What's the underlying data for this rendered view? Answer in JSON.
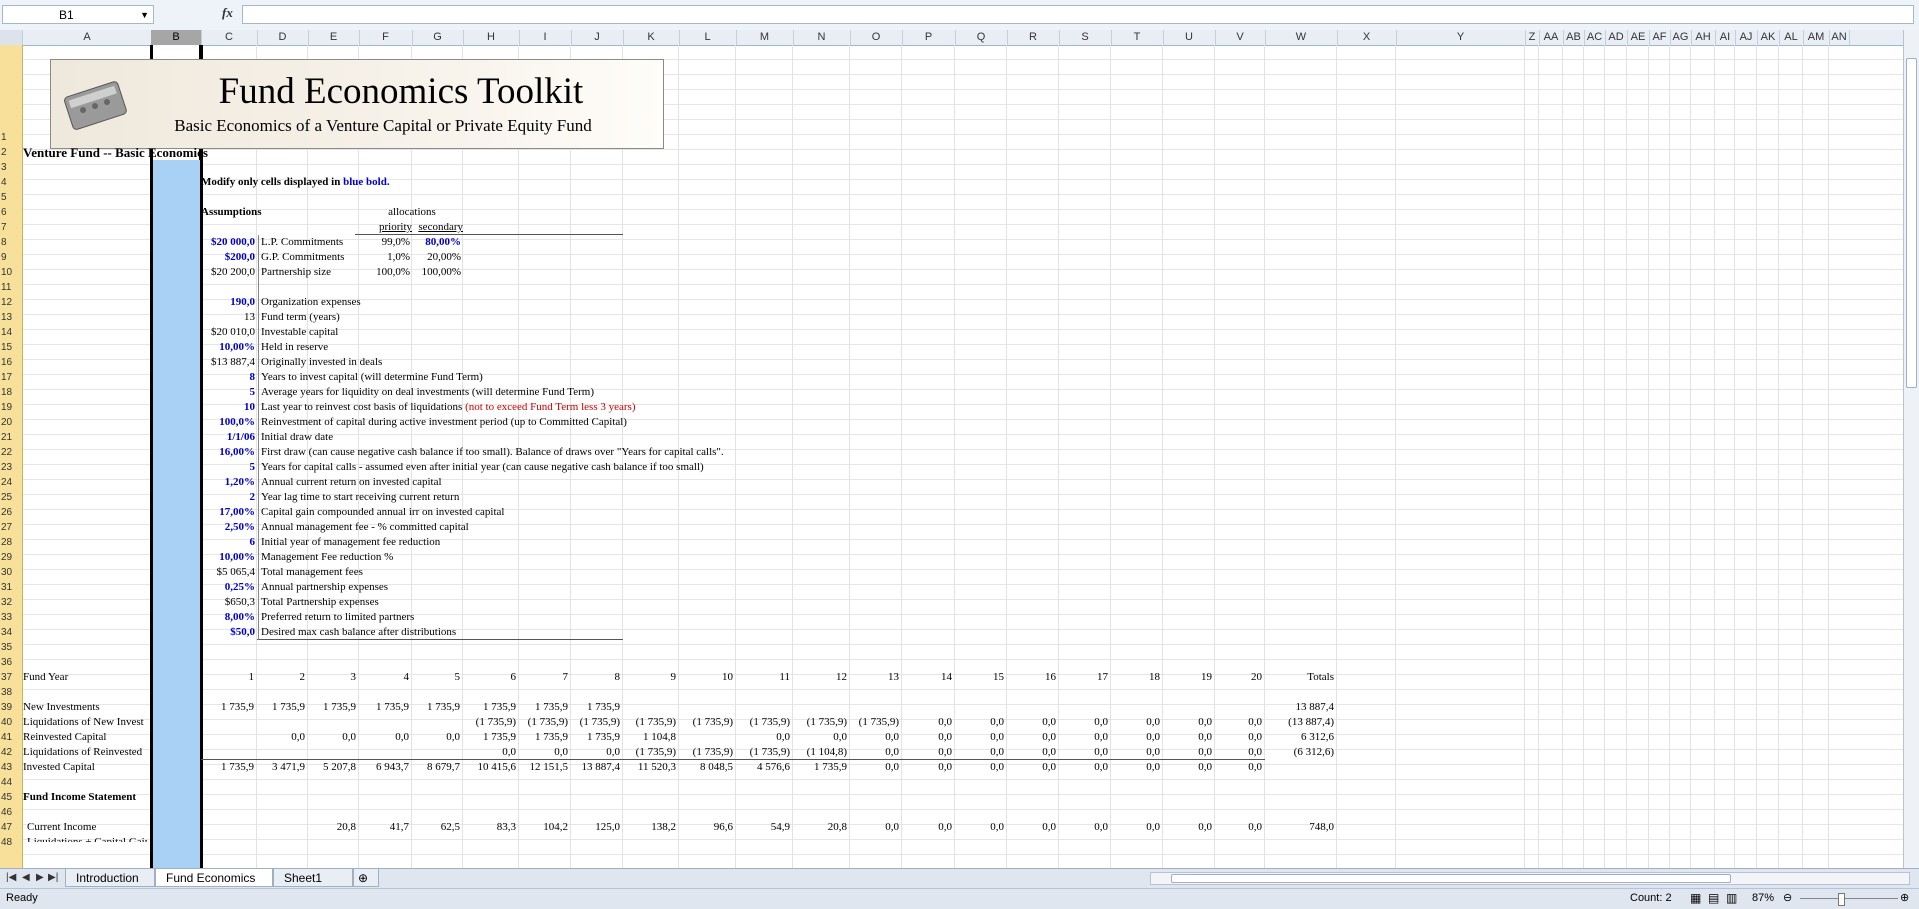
{
  "formula_bar": {
    "name_box": "B1",
    "fx": "fx",
    "formula": ""
  },
  "columns": [
    "A",
    "B",
    "C",
    "D",
    "E",
    "F",
    "G",
    "H",
    "I",
    "J",
    "K",
    "L",
    "M",
    "N",
    "O",
    "P",
    "Q",
    "R",
    "S",
    "T",
    "U",
    "V",
    "W",
    "X",
    "Y",
    "Z",
    "AA",
    "AB",
    "AC",
    "AD",
    "AE",
    "AF",
    "AG",
    "AH",
    "AI",
    "AJ",
    "AK",
    "AL",
    "AM",
    "AN"
  ],
  "selected_column": "B",
  "rows": [
    "1",
    "2",
    "3",
    "4",
    "5",
    "6",
    "7",
    "8",
    "9",
    "10",
    "11",
    "12",
    "13",
    "14",
    "15",
    "16",
    "17",
    "18",
    "19",
    "20",
    "21",
    "22",
    "23",
    "24",
    "25",
    "26",
    "27",
    "28",
    "29",
    "30",
    "31",
    "32",
    "33",
    "34",
    "35",
    "36",
    "37",
    "38",
    "39",
    "40",
    "41",
    "42",
    "43",
    "44",
    "45",
    "46",
    "47",
    "48"
  ],
  "banner": {
    "title": "Fund Economics Toolkit",
    "subtitle": "Basic Economics of a Venture Capital or Private Equity Fund"
  },
  "sheet": {
    "title": "Venture Fund -- Basic Economics",
    "instruction_prefix": "Modify only cells displayed in ",
    "instruction_blue": "blue bold.",
    "assumptions_label": "Assumptions",
    "allocations_label": "allocations",
    "priority_label": "priority",
    "secondary_label": "secondary",
    "commitments": [
      {
        "value": "$20 000,0",
        "label": "L.P. Commitments",
        "priority": "99,0%",
        "secondary": "80,00%",
        "blue": true
      },
      {
        "value": "$200,0",
        "label": "G.P. Commitments",
        "priority": "1,0%",
        "secondary": "20,00%",
        "blue": true
      },
      {
        "value": "$20 200,0",
        "label": "Partnership size",
        "priority": "100,0%",
        "secondary": "100,00%",
        "blue": false
      }
    ],
    "assumptions": [
      {
        "row": 12,
        "value": "190,0",
        "label": "Organization expenses",
        "blue": true
      },
      {
        "row": 13,
        "value": "13",
        "label": "Fund term (years)",
        "blue": false
      },
      {
        "row": 14,
        "value": "$20 010,0",
        "label": "Investable capital",
        "blue": false
      },
      {
        "row": 15,
        "value": "10,00%",
        "label": "Held in reserve",
        "blue": true
      },
      {
        "row": 16,
        "value": "$13 887,4",
        "label": "Originally invested in deals",
        "blue": false
      },
      {
        "row": 17,
        "value": "8",
        "label": "Years to invest capital (will determine Fund Term)",
        "blue": true
      },
      {
        "row": 18,
        "value": "5",
        "label": "Average years for liquidity on deal investments (will determine Fund Term)",
        "blue": true
      },
      {
        "row": 19,
        "value": "10",
        "label": "Last year to reinvest cost basis of liquidations ",
        "red": "(not to exceed Fund Term less 3 years)",
        "blue": true
      },
      {
        "row": 20,
        "value": "100,0%",
        "label": "Reinvestment of capital during active investment period (up to Committed Capital)",
        "blue": true
      },
      {
        "row": 21,
        "value": "1/1/06",
        "label": "Initial draw date",
        "blue": true
      },
      {
        "row": 22,
        "value": "16,00%",
        "label": "First draw (can cause negative cash balance if too small).  Balance of draws over \"Years for capital calls\".",
        "blue": true
      },
      {
        "row": 23,
        "value": "5",
        "label": "Years for capital calls - assumed even after initial year (can cause negative cash balance if too small)",
        "blue": true
      },
      {
        "row": 24,
        "value": "1,20%",
        "label": "Annual current return on invested capital",
        "blue": true
      },
      {
        "row": 25,
        "value": "2",
        "label": "Year lag time to start receiving current return",
        "blue": true
      },
      {
        "row": 26,
        "value": "17,00%",
        "label": "Capital gain compounded annual irr on invested capital",
        "blue": true
      },
      {
        "row": 27,
        "value": "2,50%",
        "label": "Annual management fee - % committed capital",
        "blue": true
      },
      {
        "row": 28,
        "value": "6",
        "label": "Initial year of management fee reduction",
        "blue": true
      },
      {
        "row": 29,
        "value": "10,00%",
        "label": "Management Fee reduction %",
        "blue": true
      },
      {
        "row": 30,
        "value": "$5 065,4",
        "label": "Total management fees",
        "blue": false
      },
      {
        "row": 31,
        "value": "0,25%",
        "label": "Annual partnership expenses",
        "blue": true
      },
      {
        "row": 32,
        "value": "$650,3",
        "label": "Total Partnership expenses",
        "blue": false
      },
      {
        "row": 33,
        "value": "8,00%",
        "label": "Preferred return to limited partners",
        "blue": true
      },
      {
        "row": 34,
        "value": "$50,0",
        "label": "Desired max cash balance after distributions",
        "blue": true
      }
    ],
    "fund_year_label": "Fund Year",
    "totals_label": "Totals",
    "years": [
      "1",
      "2",
      "3",
      "4",
      "5",
      "6",
      "7",
      "8",
      "9",
      "10",
      "11",
      "12",
      "13",
      "14",
      "15",
      "16",
      "17",
      "18",
      "19",
      "20"
    ],
    "table_rows": [
      {
        "row": 39,
        "label": "New Investments",
        "values": [
          "1 735,9",
          "1 735,9",
          "1 735,9",
          "1 735,9",
          "1 735,9",
          "1 735,9",
          "1 735,9",
          "1 735,9",
          "",
          "",
          "",
          "",
          "",
          "",
          "",
          "",
          "",
          "",
          "",
          ""
        ],
        "total": "13 887,4"
      },
      {
        "row": 40,
        "label": "Liquidations of New Invest",
        "values": [
          "",
          "",
          "",
          "",
          "",
          "(1 735,9)",
          "(1 735,9)",
          "(1 735,9)",
          "(1 735,9)",
          "(1 735,9)",
          "(1 735,9)",
          "(1 735,9)",
          "(1 735,9)",
          "0,0",
          "0,0",
          "0,0",
          "0,0",
          "0,0",
          "0,0",
          "0,0"
        ],
        "total": "(13 887,4)"
      },
      {
        "row": 41,
        "label": "Reinvested Capital",
        "values": [
          "",
          "0,0",
          "0,0",
          "0,0",
          "0,0",
          "1 735,9",
          "1 735,9",
          "1 735,9",
          "1 104,8",
          "",
          "0,0",
          "0,0",
          "0,0",
          "0,0",
          "0,0",
          "0,0",
          "0,0",
          "0,0",
          "0,0",
          "0,0"
        ],
        "total": "6 312,6"
      },
      {
        "row": 42,
        "label": "Liquidations of Reinvested",
        "values": [
          "",
          "",
          "",
          "",
          "",
          "0,0",
          "0,0",
          "0,0",
          "(1 735,9)",
          "(1 735,9)",
          "(1 735,9)",
          "(1 104,8)",
          "0,0",
          "0,0",
          "0,0",
          "0,0",
          "0,0",
          "0,0",
          "0,0",
          "0,0"
        ],
        "total": "(6 312,6)"
      },
      {
        "row": 43,
        "label": "Invested Capital",
        "values": [
          "1 735,9",
          "3 471,9",
          "5 207,8",
          "6 943,7",
          "8 679,7",
          "10 415,6",
          "12 151,5",
          "13 887,4",
          "11 520,3",
          "8 048,5",
          "4 576,6",
          "1 735,9",
          "0,0",
          "0,0",
          "0,0",
          "0,0",
          "0,0",
          "0,0",
          "0,0",
          "0,0"
        ],
        "total": ""
      }
    ],
    "income_statement_label": "Fund Income Statement",
    "current_income": {
      "label": "Current Income",
      "values": [
        "",
        "",
        "20,8",
        "41,7",
        "62,5",
        "83,3",
        "104,2",
        "125,0",
        "138,2",
        "96,6",
        "54,9",
        "20,8",
        "0,0",
        "0,0",
        "0,0",
        "0,0",
        "0,0",
        "0,0",
        "0,0",
        "0,0"
      ],
      "total": "748,0"
    },
    "row48_label": "Liquidations + Capital Gain"
  },
  "tabs": [
    "Introduction",
    "Fund Economics",
    "Sheet1"
  ],
  "active_tab": "Fund Economics",
  "status": {
    "ready": "Ready",
    "count": "Count: 2",
    "zoom": "87%"
  }
}
